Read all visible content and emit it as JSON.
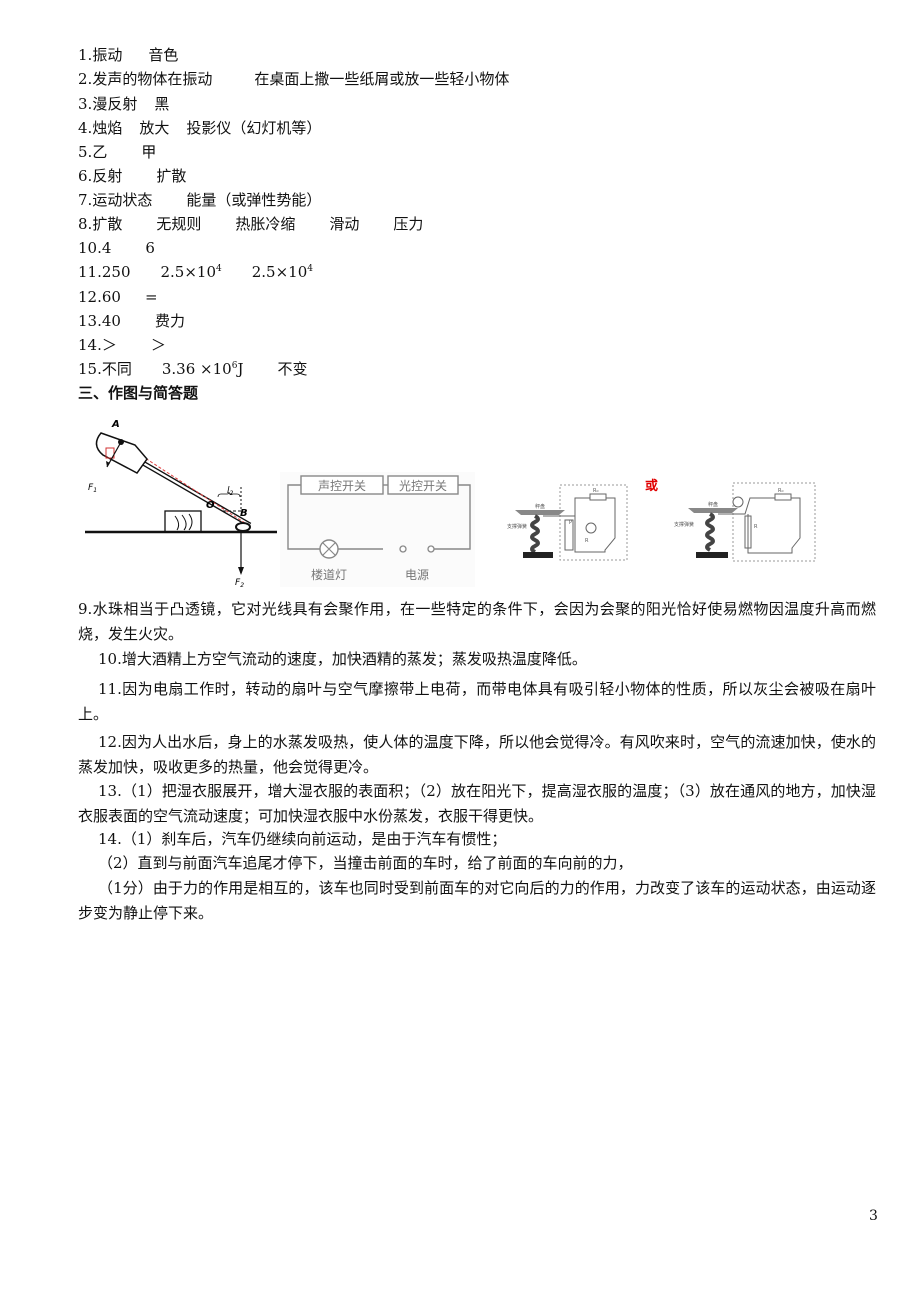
{
  "answers": [
    {
      "num": "1.",
      "items": [
        "振动",
        "音色"
      ]
    },
    {
      "num": "2.",
      "items": [
        "发声的物体在振动",
        "在桌面上撒一些纸屑或放一些轻小物体"
      ]
    },
    {
      "num": "3.",
      "items": [
        "漫反射",
        "黑"
      ]
    },
    {
      "num": "4.",
      "items": [
        "烛焰",
        "放大",
        "投影仪（幻灯机等）"
      ]
    },
    {
      "num": "5.",
      "items": [
        "乙",
        "甲"
      ]
    },
    {
      "num": "6.",
      "items": [
        "反射",
        "扩散"
      ]
    },
    {
      "num": "7.",
      "items": [
        "运动状态",
        "能量（或弹性势能）"
      ]
    },
    {
      "num": "8.",
      "items": [
        "扩散",
        "无规则",
        "热胀冷缩",
        "滑动",
        "压力"
      ]
    },
    {
      "num": "10.",
      "items": [
        "4",
        "6"
      ]
    },
    {
      "num": "11.",
      "items": [
        "250",
        "2.5×10",
        "2.5×10"
      ],
      "exponents": [
        "",
        "4",
        "4"
      ]
    },
    {
      "num": "12.",
      "items": [
        "60",
        "="
      ]
    },
    {
      "num": "13.",
      "items": [
        "40",
        "费力"
      ]
    },
    {
      "num": "14.",
      "items": [
        "＞",
        "＞"
      ]
    },
    {
      "num": "15.",
      "items": [
        "不同",
        "3.36 ×10",
        "不变"
      ],
      "exponents": [
        "",
        "6",
        ""
      ],
      "unit": "J"
    }
  ],
  "section_heading": "三、作图与简答题",
  "figures": {
    "lever": {
      "labels": {
        "a": "A",
        "o": "O",
        "b": "B",
        "f1": "F",
        "f1_sub": "1",
        "f2": "F",
        "f2_sub": "2",
        "l2": "l",
        "l2_sub": "2"
      }
    },
    "circuit": {
      "switch1": "声控开关",
      "switch2": "光控开关",
      "lamp": "楼道灯",
      "power": "电源"
    },
    "or_label": "或",
    "scale_labels": {
      "pan": "秤盘",
      "spring": "支撑弹簧",
      "r0": "R₀",
      "r": "R",
      "p": "P"
    }
  },
  "paragraphs": [
    "9.水珠相当于凸透镜，它对光线具有会聚作用，在一些特定的条件下，会因为会聚的阳光恰好使易燃物因温度升高而燃烧，发生火灾。",
    "10.增大酒精上方空气流动的速度，加快酒精的蒸发；蒸发吸热温度降低。",
    "11.因为电扇工作时，转动的扇叶与空气摩擦带上电荷，而带电体具有吸引轻小物体的性质，所以灰尘会被吸在扇叶上。",
    "12.因为人出水后，身上的水蒸发吸热，使人体的温度下降，所以他会觉得冷。有风吹来时，空气的流速加快，使水的蒸发加快，吸收更多的热量，他会觉得更冷。",
    "13.（1）把湿衣服展开，增大湿衣服的表面积；（2）放在阳光下，提高湿衣服的温度；（3）放在通风的地方，加快湿衣服表面的空气流动速度；可加快湿衣服中水份蒸发，衣服干得更快。",
    "14.（1）刹车后，汽车仍继续向前运动，是由于汽车有惯性；",
    "（2）直到与前面汽车追尾才停下，当撞击前面的车时，给了前面的车向前的力，",
    "（1分）由于力的作用是相互的，该车也同时受到前面车的对它向后的力的作用，力改变了该车的运动状态，由运动逐步变为静止停下来。"
  ],
  "page_number": "3"
}
